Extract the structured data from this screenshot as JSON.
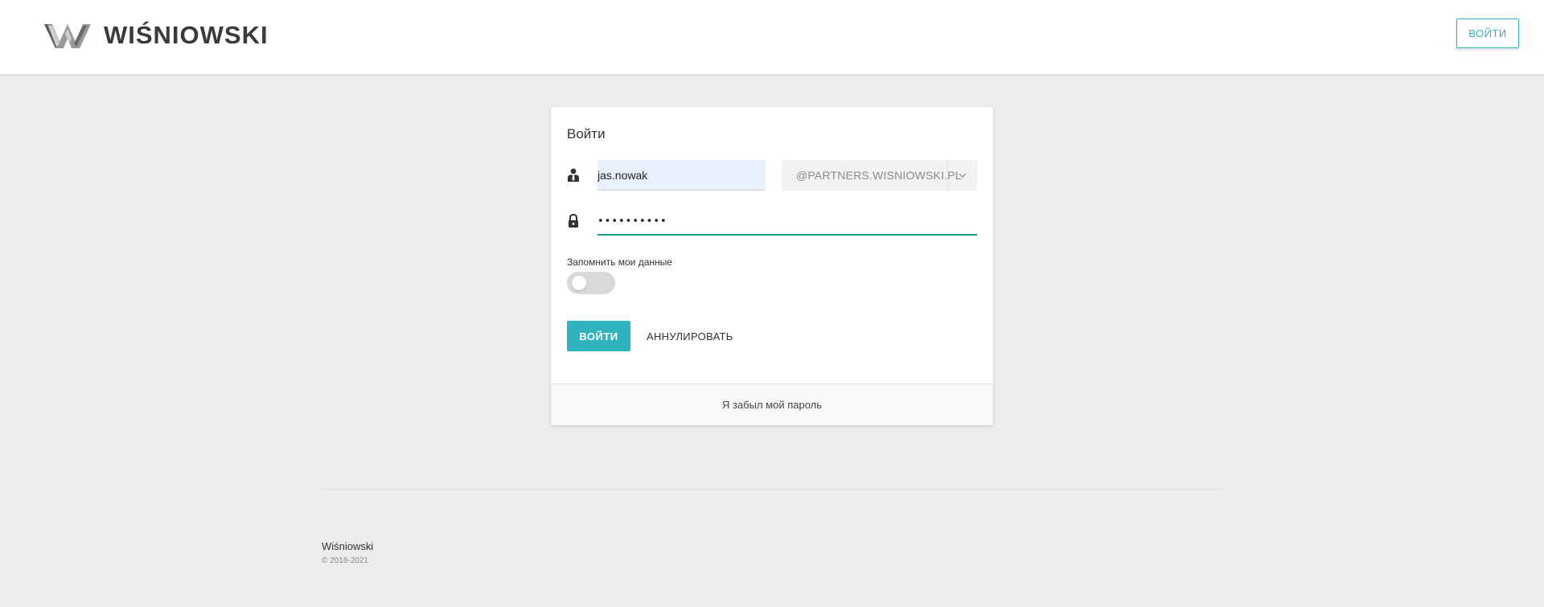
{
  "header": {
    "brand_name": "WIŚNIOWSKI",
    "login_button": "ВОЙТИ"
  },
  "login_card": {
    "title": "Войти",
    "username_value": "jas.nowak",
    "domain_selected": "@PARTNERS.WISNIOWSKI.PL",
    "password_masked": "••••••••••",
    "remember_label": "Запомнить мои данные",
    "remember_on": false,
    "submit_button": "ВОЙТИ",
    "cancel_button": "АННУЛИРОВАТЬ",
    "forgot_link": "Я забыл мой пароль"
  },
  "footer": {
    "brand": "Wiśniowski",
    "copyright": "© 2018-2021"
  },
  "colors": {
    "accent": "#2fb3bf",
    "focus_underline": "#1a9b8e",
    "background": "#ececec",
    "autofill": "#e8f0fe"
  },
  "icons": {
    "user": "user-tie-icon",
    "password": "lock-icon",
    "dropdown": "chevron-down-icon"
  }
}
